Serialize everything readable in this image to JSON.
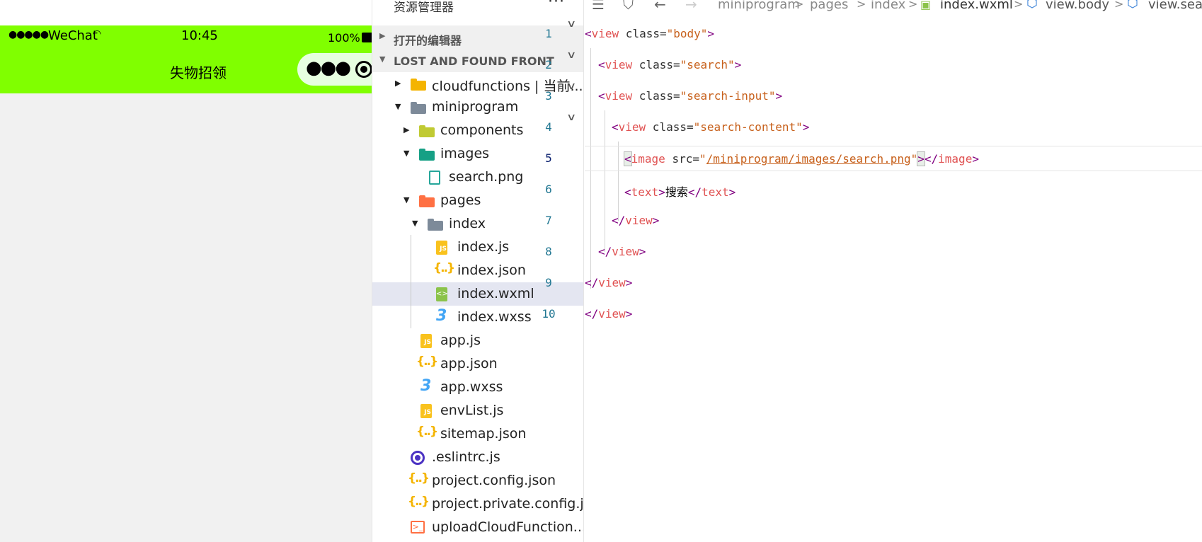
{
  "simulator": {
    "status": {
      "signal": "●●●●●",
      "carrier": "WeChat",
      "time": "10:45",
      "battery_percent": "100%"
    },
    "nav_title": "失物招领",
    "colors": {
      "nav_bg": "#80ff00",
      "page_bg": "#f1f1f1"
    }
  },
  "explorer": {
    "title": "资源管理器",
    "more": "···",
    "sections": [
      {
        "label": "打开的编辑器",
        "expanded": false
      },
      {
        "label": "LOST AND FOUND FRONT",
        "expanded": true
      }
    ],
    "items": [
      {
        "label": "cloudfunctions | 当前...",
        "icon": "folder-cloud-icon",
        "expanded": false
      },
      {
        "label": "miniprogram",
        "icon": "folder-icon",
        "expanded": true
      },
      {
        "label": "components",
        "icon": "folder-components-icon",
        "expanded": false
      },
      {
        "label": "images",
        "icon": "folder-images-icon",
        "expanded": true
      },
      {
        "label": "search.png",
        "icon": "image-file-icon"
      },
      {
        "label": "pages",
        "icon": "folder-pages-icon",
        "expanded": true
      },
      {
        "label": "index",
        "icon": "folder-icon",
        "expanded": true
      },
      {
        "label": "index.js",
        "icon": "js-file-icon"
      },
      {
        "label": "index.json",
        "icon": "json-file-icon"
      },
      {
        "label": "index.wxml",
        "icon": "wxml-file-icon",
        "selected": true
      },
      {
        "label": "index.wxss",
        "icon": "css-file-icon"
      },
      {
        "label": "app.js",
        "icon": "js-file-icon"
      },
      {
        "label": "app.json",
        "icon": "json-file-icon"
      },
      {
        "label": "app.wxss",
        "icon": "css-file-icon"
      },
      {
        "label": "envList.js",
        "icon": "js-file-icon"
      },
      {
        "label": "sitemap.json",
        "icon": "json-file-icon"
      },
      {
        "label": ".eslintrc.js",
        "icon": "eslint-file-icon"
      },
      {
        "label": "project.config.json",
        "icon": "json-file-icon"
      },
      {
        "label": "project.private.config.js...",
        "icon": "json-file-icon"
      },
      {
        "label": "uploadCloudFunction....",
        "icon": "terminal-file-icon"
      }
    ],
    "json_glyph": "{..}",
    "js_glyph": "JS",
    "wxss_glyph": "3",
    "wxml_glyph": "<>",
    "term_glyph": ">_"
  },
  "editor": {
    "breadcrumb": [
      "miniprogram",
      "pages",
      "index",
      "index.wxml",
      "view.body",
      "view.sear"
    ],
    "current_line": 5,
    "lines": [
      {
        "no": "1",
        "open": "<",
        "tag": "view",
        "attr": " class=",
        "value": "\"body\"",
        "close": ">"
      },
      {
        "no": "2",
        "open": "<",
        "tag": "view",
        "attr": " class=",
        "value": "\"search\"",
        "close": ">"
      },
      {
        "no": "3",
        "open": "<",
        "tag": "view",
        "attr": " class=",
        "value": "\"search-input\"",
        "close": ">"
      },
      {
        "no": "4",
        "open": "<",
        "tag": "view",
        "attr": " class=",
        "value": "\"search-content\"",
        "close": ">"
      },
      {
        "no": "5",
        "open": "<",
        "tag": "image",
        "attr": " src=",
        "q1": "\"",
        "link": "/miniprogram/images/search.png",
        "q2": "\"",
        "close": ">",
        "end_open": "</",
        "end_tag": "image",
        "end_close": ">"
      },
      {
        "no": "6",
        "open": "<",
        "tag": "text",
        "close": ">",
        "text": "搜索",
        "end_open": "</",
        "end_tag": "text",
        "end_close": ">"
      },
      {
        "no": "7",
        "open": "</",
        "tag": "view",
        "close": ">"
      },
      {
        "no": "8",
        "open": "</",
        "tag": "view",
        "close": ">"
      },
      {
        "no": "9",
        "open": "</",
        "tag": "view",
        "close": ">"
      },
      {
        "no": "10",
        "open": "</",
        "tag": "view",
        "close": ">"
      }
    ]
  }
}
